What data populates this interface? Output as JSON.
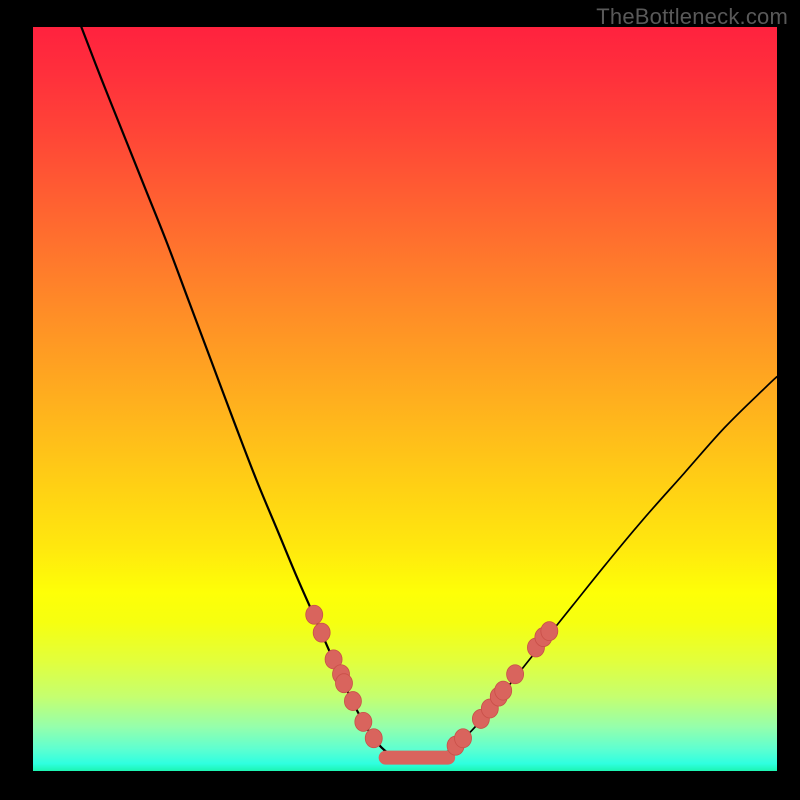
{
  "watermark": "TheBottleneck.com",
  "chart_data": {
    "type": "line",
    "title": "",
    "xlabel": "",
    "ylabel": "",
    "xlim": [
      0,
      1
    ],
    "ylim": [
      0,
      1
    ],
    "grid": false,
    "curve_left": [
      {
        "x": 0.065,
        "y": 1.0
      },
      {
        "x": 0.092,
        "y": 0.93
      },
      {
        "x": 0.12,
        "y": 0.86
      },
      {
        "x": 0.15,
        "y": 0.785
      },
      {
        "x": 0.18,
        "y": 0.71
      },
      {
        "x": 0.21,
        "y": 0.63
      },
      {
        "x": 0.24,
        "y": 0.55
      },
      {
        "x": 0.27,
        "y": 0.47
      },
      {
        "x": 0.3,
        "y": 0.392
      },
      {
        "x": 0.33,
        "y": 0.32
      },
      {
        "x": 0.355,
        "y": 0.26
      },
      {
        "x": 0.378,
        "y": 0.208
      },
      {
        "x": 0.398,
        "y": 0.162
      },
      {
        "x": 0.415,
        "y": 0.124
      },
      {
        "x": 0.43,
        "y": 0.092
      },
      {
        "x": 0.445,
        "y": 0.064
      },
      {
        "x": 0.458,
        "y": 0.044
      },
      {
        "x": 0.468,
        "y": 0.032
      },
      {
        "x": 0.478,
        "y": 0.024
      },
      {
        "x": 0.49,
        "y": 0.022
      }
    ],
    "curve_right": [
      {
        "x": 0.545,
        "y": 0.022
      },
      {
        "x": 0.56,
        "y": 0.028
      },
      {
        "x": 0.575,
        "y": 0.04
      },
      {
        "x": 0.595,
        "y": 0.06
      },
      {
        "x": 0.62,
        "y": 0.09
      },
      {
        "x": 0.65,
        "y": 0.128
      },
      {
        "x": 0.685,
        "y": 0.172
      },
      {
        "x": 0.725,
        "y": 0.222
      },
      {
        "x": 0.77,
        "y": 0.278
      },
      {
        "x": 0.82,
        "y": 0.338
      },
      {
        "x": 0.875,
        "y": 0.4
      },
      {
        "x": 0.93,
        "y": 0.462
      },
      {
        "x": 0.985,
        "y": 0.516
      },
      {
        "x": 1.0,
        "y": 0.53
      }
    ],
    "markers_left": [
      {
        "x": 0.378,
        "y": 0.21
      },
      {
        "x": 0.388,
        "y": 0.186
      },
      {
        "x": 0.404,
        "y": 0.15
      },
      {
        "x": 0.414,
        "y": 0.13
      },
      {
        "x": 0.418,
        "y": 0.118
      },
      {
        "x": 0.43,
        "y": 0.094
      },
      {
        "x": 0.444,
        "y": 0.066
      },
      {
        "x": 0.458,
        "y": 0.044
      }
    ],
    "markers_right": [
      {
        "x": 0.568,
        "y": 0.034
      },
      {
        "x": 0.578,
        "y": 0.044
      },
      {
        "x": 0.602,
        "y": 0.07
      },
      {
        "x": 0.614,
        "y": 0.084
      },
      {
        "x": 0.626,
        "y": 0.1
      },
      {
        "x": 0.632,
        "y": 0.108
      },
      {
        "x": 0.648,
        "y": 0.13
      },
      {
        "x": 0.676,
        "y": 0.166
      },
      {
        "x": 0.686,
        "y": 0.18
      },
      {
        "x": 0.694,
        "y": 0.188
      }
    ],
    "flat_segment": {
      "x_start": 0.474,
      "x_end": 0.558,
      "y": 0.018
    }
  }
}
